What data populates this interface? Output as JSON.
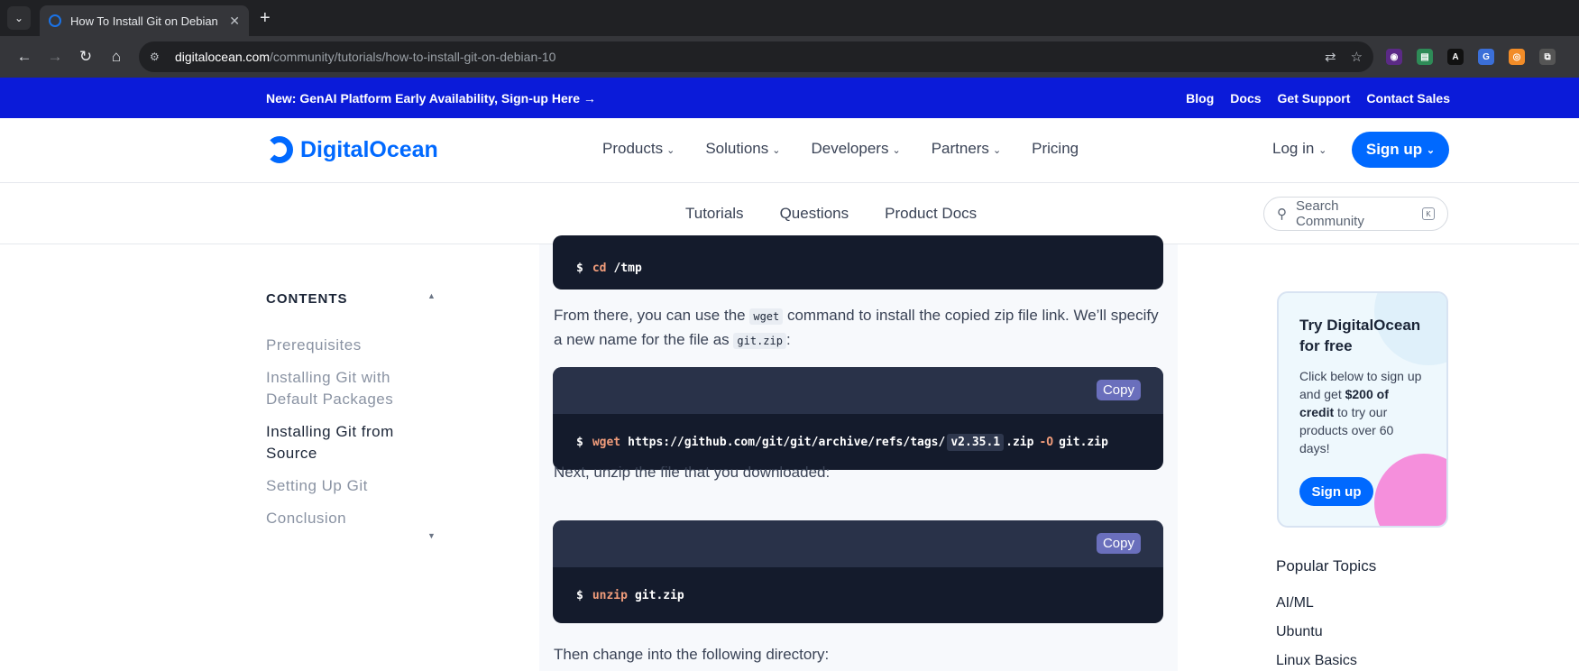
{
  "browser": {
    "tab_title": "How To Install Git on Debian 10",
    "url_host": "digitalocean.com",
    "url_path": "/community/tutorials/how-to-install-git-on-debian-10"
  },
  "promo": {
    "message": "New: GenAI Platform Early Availability, Sign-up Here →",
    "links": [
      "Blog",
      "Docs",
      "Get Support",
      "Contact Sales"
    ]
  },
  "header": {
    "logo_text": "DigitalOcean",
    "nav": [
      "Products",
      "Solutions",
      "Developers",
      "Partners",
      "Pricing"
    ],
    "login": "Log in",
    "signup": "Sign up"
  },
  "subnav": {
    "items": [
      "Tutorials",
      "Questions",
      "Product Docs"
    ],
    "search_placeholder": "Search Community"
  },
  "toc": {
    "heading": "CONTENTS",
    "items": [
      "Prerequisites",
      "Installing Git with Default Packages",
      "Installing Git from Source",
      "Setting Up Git",
      "Conclusion"
    ],
    "active_index": 2
  },
  "article": {
    "code1": {
      "prompt": "$",
      "cmd": "cd",
      "args": "/tmp"
    },
    "para1_a": "From there, you can use the ",
    "para1_code1": "wget",
    "para1_b": " command to install the copied zip file link. We’ll specify a new name for the file as ",
    "para1_code2": "git.zip",
    "para1_c": ":",
    "code2": {
      "copy": "Copy",
      "prompt": "$",
      "cmd": "wget",
      "url": "https://github.com/git/git/archive/refs/tags/",
      "version": "v2.35.1",
      "ext": ".zip",
      "flag": "-O",
      "out": "git.zip"
    },
    "para2": "Next, unzip the file that you downloaded:",
    "code3": {
      "copy": "Copy",
      "prompt": "$",
      "cmd": "unzip",
      "args": "git.zip"
    },
    "para3": "Then change into the following directory:"
  },
  "sidebar_card": {
    "title": "Try DigitalOcean for free",
    "text_a": "Click below to sign up and get ",
    "text_bold": "$200 of credit",
    "text_b": " to try our products over 60 days!",
    "button": "Sign up"
  },
  "topics": {
    "heading": "Popular Topics",
    "items": [
      "AI/ML",
      "Ubuntu",
      "Linux Basics"
    ]
  },
  "colors": {
    "brand": "#0069ff",
    "promo_bar": "#0b1bd9",
    "code_bg": "#141b2c",
    "code_bar": "#293249",
    "copy_btn": "#6a6fbc"
  }
}
